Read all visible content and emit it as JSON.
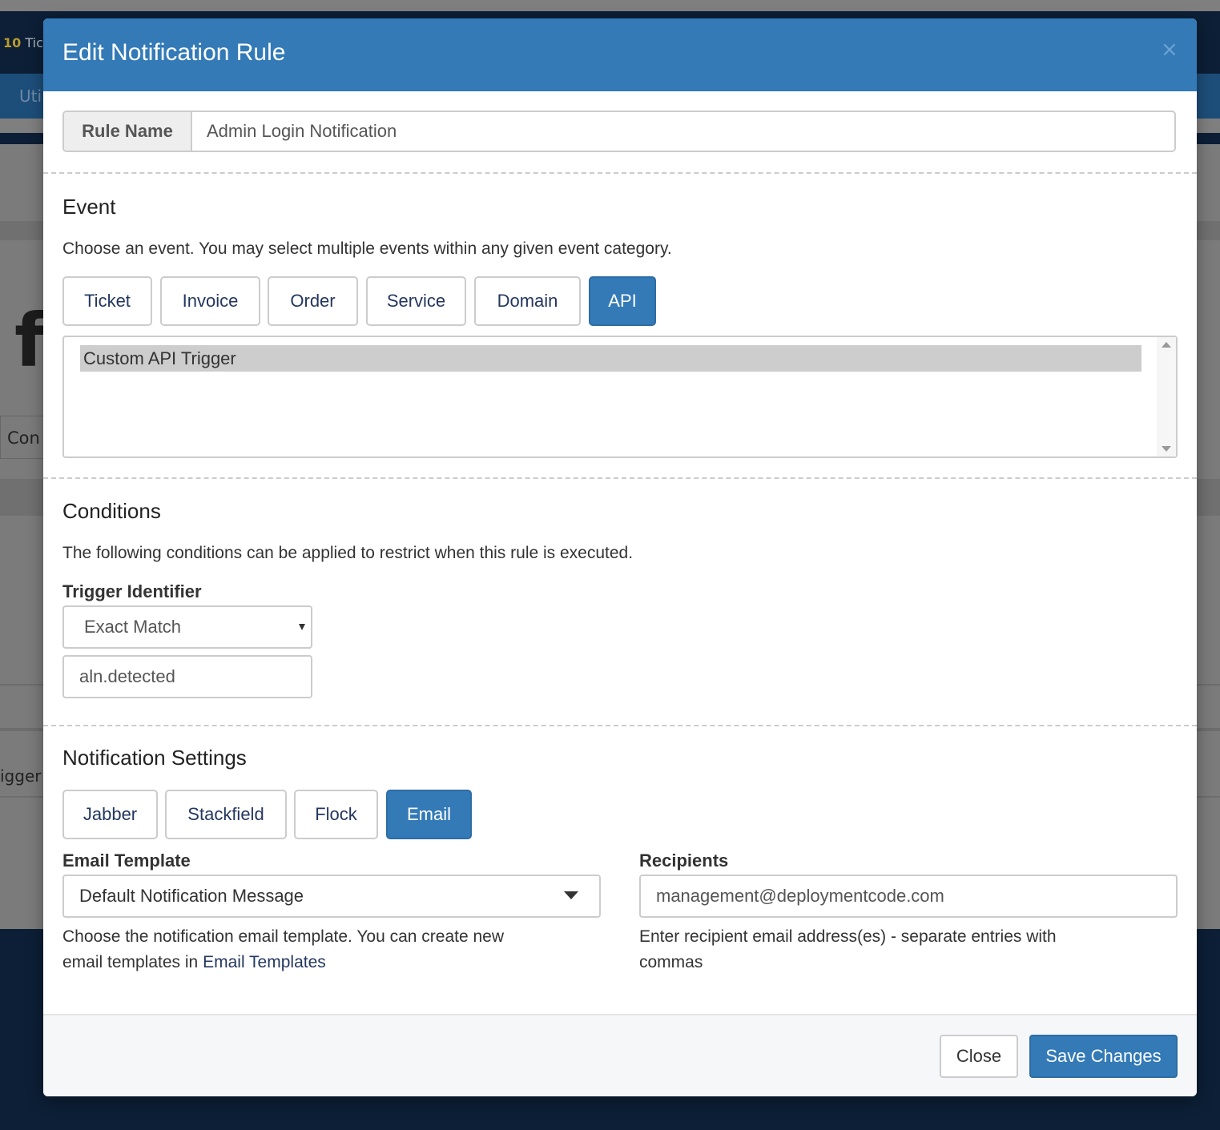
{
  "background": {
    "tickets_count": "10",
    "tickets_text": "Tic",
    "nav_text": "Uti",
    "big_letter": "f",
    "cont_text": "Con",
    "trigger_text": "igger"
  },
  "modal": {
    "title": "Edit Notification Rule",
    "close_symbol": "×",
    "rule_name_label": "Rule Name",
    "rule_name_value": "Admin Login Notification"
  },
  "event": {
    "title": "Event",
    "description": "Choose an event. You may select multiple events within any given event category.",
    "tabs": [
      {
        "label": "Ticket",
        "active": false
      },
      {
        "label": "Invoice",
        "active": false
      },
      {
        "label": "Order",
        "active": false
      },
      {
        "label": "Service",
        "active": false
      },
      {
        "label": "Domain",
        "active": false
      },
      {
        "label": "API",
        "active": true
      }
    ],
    "list_items": [
      "Custom API Trigger"
    ]
  },
  "conditions": {
    "title": "Conditions",
    "description": "The following conditions can be applied to restrict when this rule is executed.",
    "trigger_label": "Trigger Identifier",
    "match_type": "Exact Match",
    "trigger_value": "aln.detected"
  },
  "notification": {
    "title": "Notification Settings",
    "tabs": [
      {
        "label": "Jabber",
        "active": false
      },
      {
        "label": "Stackfield",
        "active": false
      },
      {
        "label": "Flock",
        "active": false
      },
      {
        "label": "Email",
        "active": true
      }
    ],
    "template_label": "Email Template",
    "template_value": "Default Notification Message",
    "template_help_1": "Choose the notification email template. You can create new",
    "template_help_2": "email templates in",
    "template_help_link": "Email Templates",
    "recipients_label": "Recipients",
    "recipients_value": "management@deploymentcode.com",
    "recipients_help_1": "Enter recipient email address(es) - separate entries with",
    "recipients_help_2": "commas"
  },
  "footer": {
    "close_label": "Close",
    "save_label": "Save Changes"
  },
  "colors": {
    "primary": "#337ab7",
    "link": "#23375f",
    "backdrop_dark": "#0c1f36"
  }
}
